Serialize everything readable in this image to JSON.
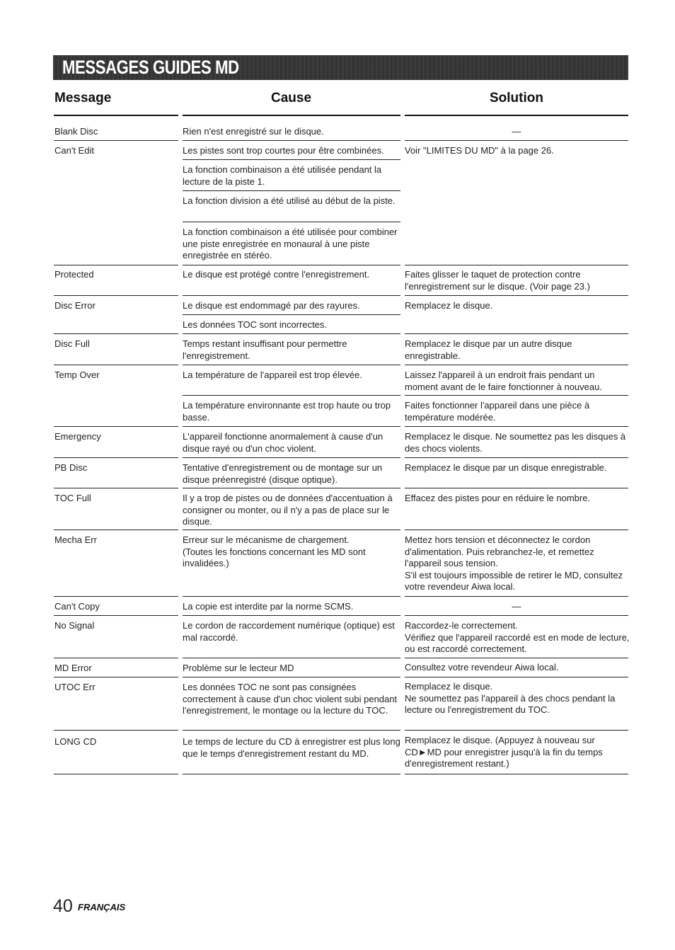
{
  "banner": {
    "title": "MESSAGES GUIDES MD"
  },
  "headers": {
    "message": "Message",
    "cause": "Cause",
    "solution": "Solution"
  },
  "rows": [
    {
      "message": "Blank Disc",
      "causes": [
        "Rien n'est enregistré sur le disque."
      ],
      "solutions": [
        "—"
      ]
    },
    {
      "message": "Can't Edit",
      "causes": [
        "Les pistes sont trop courtes pour être combinées.",
        "La fonction combinaison a été utilisée pendant la lecture de la piste 1.",
        "La fonction division a été utilisé au début de la piste.",
        "La fonction combinaison a été utilisée pour combiner une piste enregistrée en monaural à une piste enregistrée en stéréo."
      ],
      "solutions": [
        "Voir \"LIMITES DU MD\" à la page 26."
      ]
    },
    {
      "message": "Protected",
      "causes": [
        "Le disque est protégé contre l'enregistrement."
      ],
      "solutions": [
        "Faites glisser le taquet de protection contre l'enregistrement sur le disque. (Voir page 23.)"
      ]
    },
    {
      "message": "Disc Error",
      "causes": [
        "Le disque est endommagé par des rayures.",
        "Les données TOC sont incorrectes."
      ],
      "solutions": [
        "Remplacez le disque."
      ]
    },
    {
      "message": "Disc Full",
      "causes": [
        "Temps restant insuffisant pour permettre l'enregistrement."
      ],
      "solutions": [
        "Remplacez le disque par un autre disque enregistrable."
      ]
    },
    {
      "message": "Temp Over",
      "causes": [
        "La température de l'appareil est trop élevée.",
        "La température environnante est trop haute ou trop basse."
      ],
      "solutions": [
        "Laissez l'appareil à un endroit frais pendant un moment avant de le faire fonctionner à nouveau.",
        "Faites fonctionner l'appareil dans une pièce à température modérée."
      ]
    },
    {
      "message": "Emergency",
      "causes": [
        "L'appareil fonctionne anormalement à cause d'un disque rayé ou d'un choc violent."
      ],
      "solutions": [
        "Remplacez le disque. Ne soumettez pas les disques à des chocs violents."
      ]
    },
    {
      "message": "PB Disc",
      "causes": [
        "Tentative d'enregistrement ou de montage sur un disque préenregistré (disque optique)."
      ],
      "solutions": [
        "Remplacez le disque par un disque enregistrable."
      ]
    },
    {
      "message": "TOC Full",
      "causes": [
        "Il y a trop de pistes ou de données d'accentuation à consigner ou monter, ou il n'y a pas de place sur le disque."
      ],
      "solutions": [
        "Effacez des pistes pour en réduire le nombre."
      ]
    },
    {
      "message": "Mecha Err",
      "causes": [
        "Erreur sur le mécanisme de chargement.\n(Toutes les fonctions concernant les MD sont invalidées.)"
      ],
      "solutions": [
        "Mettez hors tension et déconnectez le cordon d'alimentation. Puis rebranchez-le, et remettez l'appareil sous tension.\nS'il est toujours impossible de retirer le MD, consultez votre revendeur Aiwa local."
      ]
    },
    {
      "message": "Can't Copy",
      "causes": [
        "La copie est interdite par la norme SCMS."
      ],
      "solutions": [
        "—"
      ]
    },
    {
      "message": "No Signal",
      "causes": [
        "Le cordon de raccordement numérique (optique) est mal raccordé."
      ],
      "solutions": [
        "Raccordez-le correctement.\nVérifiez que l'appareil raccordé est en mode de lecture, ou est raccordé correctement."
      ]
    },
    {
      "message": "MD Error",
      "causes": [
        "Problème sur le lecteur MD"
      ],
      "solutions": [
        "Consultez votre revendeur Aiwa local."
      ]
    },
    {
      "message": "UTOC Err",
      "causes": [
        "Les données TOC ne sont pas consignées correctement à cause d'un choc violent subi pendant l'enregistrement, le montage ou la lecture du TOC."
      ],
      "solutions": [
        "Remplacez le disque.\nNe soumettez pas l'appareil à des chocs pendant la lecture ou l'enregistrement du TOC."
      ]
    },
    {
      "message": "LONG CD",
      "causes": [
        "Le temps de lecture du CD à enregistrer est plus long que le temps d'enregistrement restant du MD."
      ],
      "solutions": [
        "Remplacez le disque. (Appuyez à nouveau sur CD►MD pour enregistrer jusqu'à la fin du temps d'enregistrement restant.)"
      ]
    }
  ],
  "footer": {
    "page_number": "40",
    "language": "FRANÇAIS"
  }
}
